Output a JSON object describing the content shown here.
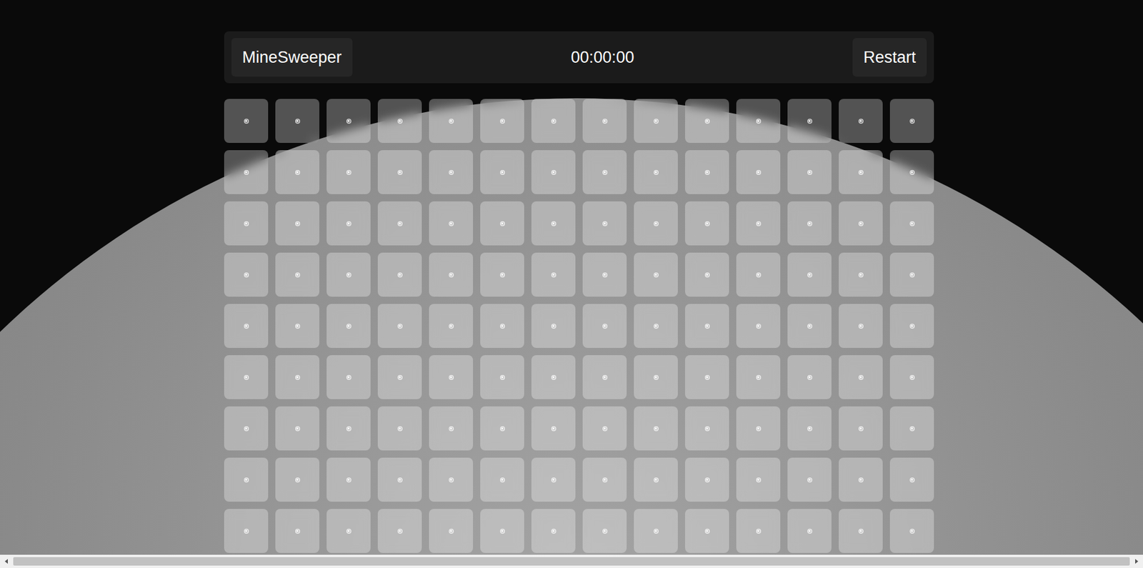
{
  "header": {
    "title": "MineSweeper",
    "timer": "00:00:00",
    "restart": "Restart"
  },
  "board": {
    "rows": [
      [
        {
          "revealed": false
        },
        {
          "revealed": false
        },
        {
          "revealed": false
        },
        {
          "revealed": false
        },
        {
          "revealed": false
        },
        {
          "revealed": false
        },
        {
          "revealed": false
        },
        {
          "revealed": false
        },
        {
          "revealed": false
        },
        {
          "revealed": false
        },
        {
          "revealed": false
        },
        {
          "revealed": false
        },
        {
          "revealed": false
        },
        {
          "revealed": false
        }
      ],
      [
        {
          "revealed": false
        },
        {
          "revealed": false
        },
        {
          "revealed": false
        },
        {
          "revealed": false
        },
        {
          "revealed": false
        },
        {
          "revealed": false
        },
        {
          "revealed": false
        },
        {
          "revealed": false
        },
        {
          "revealed": false
        },
        {
          "revealed": false
        },
        {
          "revealed": false
        },
        {
          "revealed": false
        },
        {
          "revealed": false
        },
        {
          "revealed": false
        }
      ],
      [
        {
          "revealed": false
        },
        {
          "revealed": false
        },
        {
          "revealed": false
        },
        {
          "revealed": false
        },
        {
          "revealed": false
        },
        {
          "revealed": false
        },
        {
          "revealed": false
        },
        {
          "revealed": false
        },
        {
          "revealed": false
        },
        {
          "revealed": false
        },
        {
          "revealed": false
        },
        {
          "revealed": false
        },
        {
          "revealed": false
        },
        {
          "revealed": false
        }
      ],
      [
        {
          "revealed": false
        },
        {
          "revealed": false
        },
        {
          "revealed": false
        },
        {
          "revealed": false
        },
        {
          "revealed": false
        },
        {
          "revealed": false
        },
        {
          "revealed": false
        },
        {
          "revealed": false
        },
        {
          "revealed": false
        },
        {
          "revealed": false
        },
        {
          "revealed": false
        },
        {
          "revealed": false
        },
        {
          "revealed": false
        },
        {
          "revealed": false
        }
      ],
      [
        {
          "revealed": false
        },
        {
          "revealed": false
        },
        {
          "revealed": false
        },
        {
          "revealed": false
        },
        {
          "revealed": false
        },
        {
          "revealed": false
        },
        {
          "revealed": false
        },
        {
          "revealed": false
        },
        {
          "revealed": false
        },
        {
          "revealed": false
        },
        {
          "revealed": false
        },
        {
          "revealed": false
        },
        {
          "revealed": false
        },
        {
          "revealed": false
        }
      ],
      [
        {
          "revealed": false
        },
        {
          "revealed": false
        },
        {
          "revealed": false
        },
        {
          "revealed": false
        },
        {
          "revealed": false
        },
        {
          "revealed": false
        },
        {
          "revealed": false
        },
        {
          "revealed": false
        },
        {
          "revealed": false
        },
        {
          "revealed": false
        },
        {
          "revealed": false
        },
        {
          "revealed": false
        },
        {
          "revealed": false
        },
        {
          "revealed": false
        }
      ],
      [
        {
          "revealed": false
        },
        {
          "revealed": false
        },
        {
          "revealed": false
        },
        {
          "revealed": false
        },
        {
          "revealed": false
        },
        {
          "revealed": false
        },
        {
          "revealed": false
        },
        {
          "revealed": false
        },
        {
          "revealed": false
        },
        {
          "revealed": false
        },
        {
          "revealed": false
        },
        {
          "revealed": false
        },
        {
          "revealed": false
        },
        {
          "revealed": false
        }
      ],
      [
        {
          "revealed": false
        },
        {
          "revealed": false
        },
        {
          "revealed": false
        },
        {
          "revealed": false
        },
        {
          "revealed": false
        },
        {
          "revealed": false
        },
        {
          "revealed": false
        },
        {
          "revealed": false
        },
        {
          "revealed": false
        },
        {
          "revealed": false
        },
        {
          "revealed": false
        },
        {
          "revealed": false
        },
        {
          "revealed": false
        },
        {
          "revealed": false
        }
      ],
      [
        {
          "revealed": false
        },
        {
          "revealed": false
        },
        {
          "revealed": false
        },
        {
          "revealed": false
        },
        {
          "revealed": false
        },
        {
          "revealed": false
        },
        {
          "revealed": false
        },
        {
          "revealed": false
        },
        {
          "revealed": false
        },
        {
          "revealed": false
        },
        {
          "revealed": false
        },
        {
          "revealed": false
        },
        {
          "revealed": false
        },
        {
          "revealed": false
        }
      ]
    ]
  }
}
